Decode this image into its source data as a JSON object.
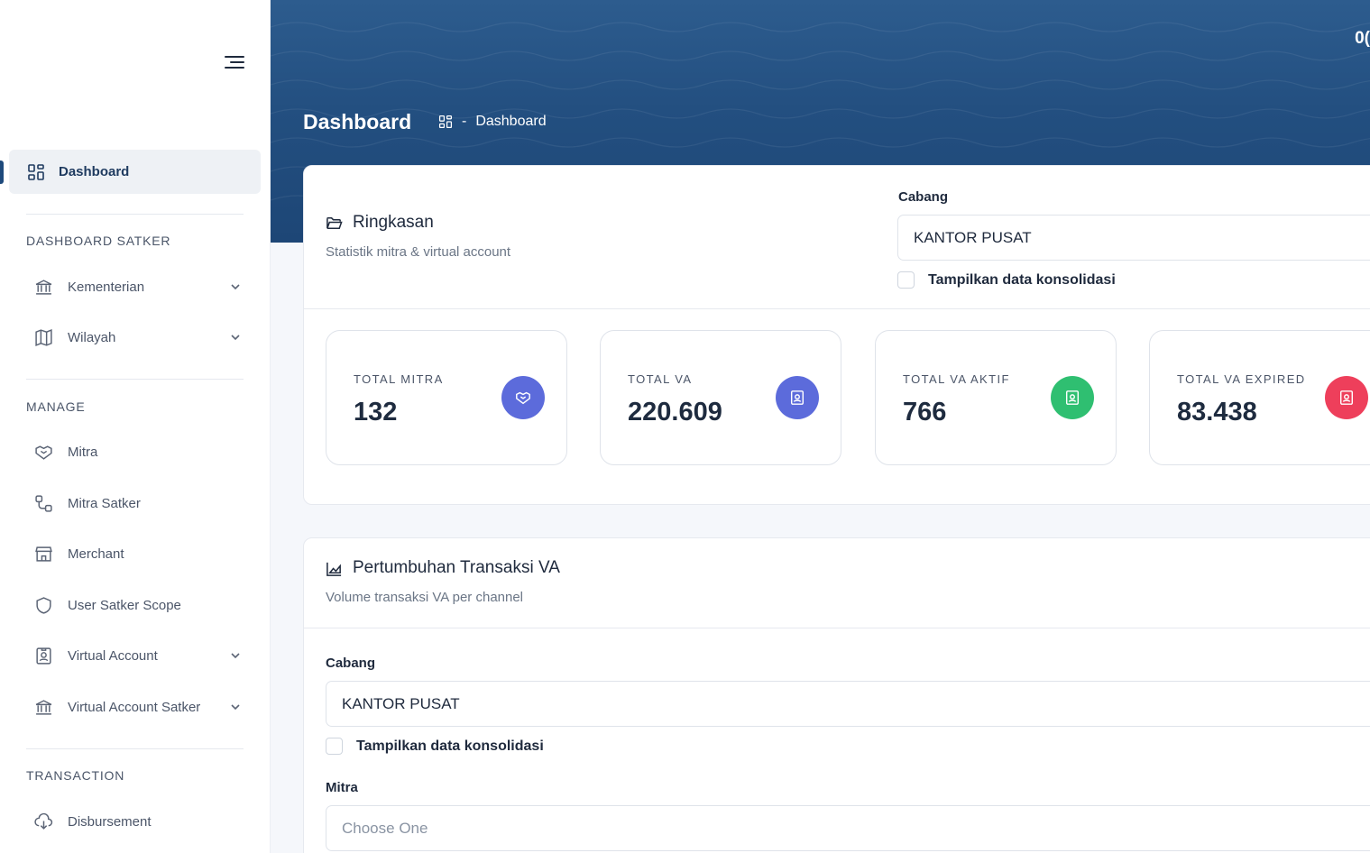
{
  "sidebar": {
    "active": {
      "label": "Dashboard",
      "icon": "grid-icon"
    },
    "sections": [
      {
        "title": "DASHBOARD SATKER",
        "items": [
          {
            "label": "Kementerian",
            "icon": "bank-icon",
            "expandable": true
          },
          {
            "label": "Wilayah",
            "icon": "map-icon",
            "expandable": true
          }
        ]
      },
      {
        "title": "MANAGE",
        "items": [
          {
            "label": "Mitra",
            "icon": "handshake-icon",
            "expandable": false
          },
          {
            "label": "Mitra Satker",
            "icon": "flow-icon",
            "expandable": false
          },
          {
            "label": "Merchant",
            "icon": "store-icon",
            "expandable": false
          },
          {
            "label": "User Satker Scope",
            "icon": "shield-icon",
            "expandable": false
          },
          {
            "label": "Virtual Account",
            "icon": "id-badge-icon",
            "expandable": true
          },
          {
            "label": "Virtual Account Satker",
            "icon": "bank-icon",
            "expandable": true
          }
        ]
      },
      {
        "title": "TRANSACTION",
        "items": [
          {
            "label": "Disbursement",
            "icon": "cloud-download-icon",
            "expandable": false
          }
        ]
      }
    ]
  },
  "header": {
    "title": "Dashboard",
    "breadcrumb": {
      "separator": "-",
      "current": "Dashboard"
    },
    "corner_text": "0("
  },
  "summary": {
    "title": "Ringkasan",
    "subtitle": "Statistik mitra & virtual account",
    "cabang_label": "Cabang",
    "cabang_value": "KANTOR PUSAT",
    "consolidate_label": "Tampilkan data konsolidasi",
    "consolidate_checked": false,
    "stats": [
      {
        "label": "TOTAL MITRA",
        "value": "132",
        "icon": "handshake-icon",
        "color": "#5c6bdb"
      },
      {
        "label": "TOTAL VA",
        "value": "220.609",
        "icon": "id-badge-icon",
        "color": "#5c6bdb"
      },
      {
        "label": "TOTAL VA AKTIF",
        "value": "766",
        "icon": "id-badge-icon",
        "color": "#2fbf71"
      },
      {
        "label": "TOTAL VA EXPIRED",
        "value": "83.438",
        "icon": "id-badge-icon",
        "color": "#ee3f5b"
      }
    ]
  },
  "growth": {
    "title": "Pertumbuhan Transaksi VA",
    "subtitle": "Volume transaksi VA per channel",
    "cabang_label": "Cabang",
    "cabang_value": "KANTOR PUSAT",
    "consolidate_label": "Tampilkan data konsolidasi",
    "consolidate_checked": false,
    "mitra_label": "Mitra",
    "mitra_placeholder": "Choose One"
  },
  "colors": {
    "primary": "#1e4a7c",
    "header": "#234f80"
  }
}
